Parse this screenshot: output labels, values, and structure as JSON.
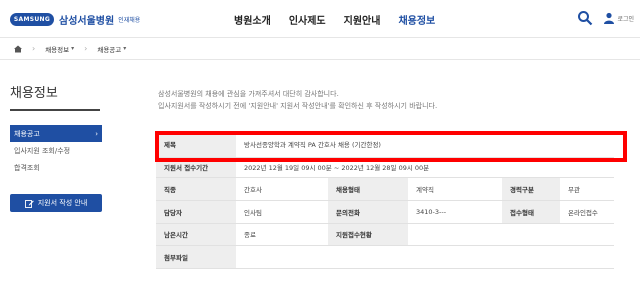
{
  "header": {
    "logo_badge": "SAMSUNG",
    "logo_name": "삼성서울병원",
    "logo_sub": "인재채용",
    "nav": [
      "병원소개",
      "인사제도",
      "지원안내",
      "채용정보"
    ],
    "active_nav": "채용정보",
    "login_label": "로그인"
  },
  "breadcrumb": {
    "items": [
      "채용정보",
      "채용공고"
    ]
  },
  "sidebar": {
    "title": "채용정보",
    "items": [
      "채용공고",
      "입사지원 조회/수정",
      "합격조회"
    ],
    "active_item": "채용공고",
    "apply_guide_button": "지원서 작성 안내"
  },
  "intro": {
    "line1": "삼성서울병원의 채용에 관심을 가져주셔서 대단히 감사합니다.",
    "line2": "입사지원서를 작성하시기 전에 '지원안내' 지원서 작성안내'를 확인하신 후 작성하시기 바랍니다."
  },
  "posting": {
    "title_label": "제목",
    "title_value": "방사선종양학과 계약직 PA 간호사 채용 (기간한정)",
    "period_label": "지원서 접수기간",
    "period_value": "2022년 12월 19일 09시 00분 ~ 2022년 12월 28일 09시 00분",
    "job_label": "직종",
    "job_value": "간호사",
    "type_label": "채용형태",
    "type_value": "계약직",
    "career_label": "경력구분",
    "career_value": "무관",
    "manager_label": "담당자",
    "manager_value": "인사팀",
    "contact_label": "문의전화",
    "contact_value": "3410-3---",
    "receipt_label": "접수형태",
    "receipt_value": "온라인접수",
    "remaining_label": "남은시간",
    "remaining_value": "종료",
    "status_label": "지원접수현황",
    "attach_label": "첨부파일"
  },
  "colors": {
    "brand": "#1f4fa3",
    "highlight": "#ff0000",
    "label_bg": "#eeeeee"
  }
}
